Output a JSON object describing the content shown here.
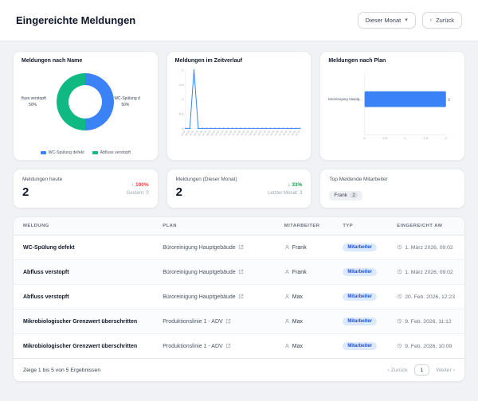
{
  "header": {
    "title": "Eingereichte Meldungen",
    "period_value": "Dieser Monat",
    "back_label": "Zurück"
  },
  "icons": {
    "caret_down": "▾",
    "chevron_left": "‹",
    "chevron_right": "›"
  },
  "charts": {
    "by_name": {
      "title": "Meldungen nach Name",
      "type": "doughnut",
      "segments": [
        {
          "label": "WC-Spülung defekt",
          "pct": 50,
          "color": "#3b82f6"
        },
        {
          "label": "Abfluss verstopft",
          "pct": 50,
          "color": "#10b981"
        }
      ],
      "callout_left": {
        "label": "fluss verstopft",
        "value": "50%"
      },
      "callout_right": {
        "label": "WC-Spülung d",
        "value": "50%"
      }
    },
    "over_time": {
      "title": "Meldungen im Zeitverlauf",
      "type": "line",
      "color": "#3b82f6",
      "y_max": 2,
      "y_ticks": [
        0,
        0.5,
        1,
        1.5,
        2
      ],
      "x": [
        "02.02",
        "03.02",
        "04.02",
        "05.02",
        "06.02",
        "07.02",
        "08.02",
        "09.02",
        "10.02",
        "11.02",
        "12.02",
        "13.02",
        "14.02",
        "15.02",
        "16.02",
        "17.02",
        "18.02",
        "19.02",
        "20.02",
        "21.02",
        "22.02",
        "23.02",
        "24.02",
        "25.02",
        "26.02",
        "27.02",
        "28.02",
        "01.03"
      ],
      "values": [
        0,
        0,
        2,
        0,
        0,
        0,
        0,
        0,
        0,
        0,
        0,
        0,
        0,
        0,
        0,
        0,
        0,
        0,
        0,
        0,
        0,
        0,
        0,
        0,
        0,
        0,
        0,
        0
      ]
    },
    "by_plan": {
      "title": "Meldungen nach Plan",
      "type": "bar-horizontal",
      "color": "#3b82f6",
      "x_max": 2,
      "x_ticks": [
        0,
        0.5,
        1,
        1.5,
        2
      ],
      "categories": [
        "Büroreinigung Hauptg..."
      ],
      "values": [
        2
      ]
    }
  },
  "stats": [
    {
      "title": "Meldungen heute",
      "value": "2",
      "delta": "↑ 100%",
      "delta_color": "#ef4444",
      "subtitle": "Gestern: 0"
    },
    {
      "title": "Meldungen (Dieser Monat)",
      "value": "2",
      "delta": "↓ 33%",
      "delta_color": "#16a34a",
      "subtitle": "Letzter Monat: 3"
    },
    {
      "title": "Top Meldende Mitarbeiter",
      "chip": {
        "name": "Frank",
        "count": "2"
      }
    }
  ],
  "table": {
    "columns": [
      "MELDUNG",
      "PLAN",
      "MITARBEITER",
      "TYP",
      "EINGEREICHT AM"
    ],
    "rows": [
      {
        "meldung": "WC-Spülung defekt",
        "plan": "Büroreinigung Hauptgebäude",
        "mitarbeiter": "Frank",
        "typ": "Mitarbeiter",
        "eingereicht": "1. März 2026, 09:02"
      },
      {
        "meldung": "Abfluss verstopft",
        "plan": "Büroreinigung Hauptgebäude",
        "mitarbeiter": "Frank",
        "typ": "Mitarbeiter",
        "eingereicht": "1. März 2026, 09:02"
      },
      {
        "meldung": "Abfluss verstopft",
        "plan": "Büroreinigung Hauptgebäude",
        "mitarbeiter": "Max",
        "typ": "Mitarbeiter",
        "eingereicht": "20. Feb. 2026, 12:23"
      },
      {
        "meldung": "Mikrobiologischer Grenzwert überschritten",
        "plan": "Produktionslinie 1 - ADV",
        "mitarbeiter": "Max",
        "typ": "Mitarbeiter",
        "eingereicht": "9. Feb. 2026, 11:12"
      },
      {
        "meldung": "Mikrobiologischer Grenzwert überschritten",
        "plan": "Produktionslinie 1 - ADV",
        "mitarbeiter": "Max",
        "typ": "Mitarbeiter",
        "eingereicht": "9. Feb. 2026, 10:09"
      }
    ],
    "footer": {
      "summary": "Zeige 1 bis 5 von 5 Ergebnissen",
      "prev": "Zurück",
      "page": "1",
      "next": "Weiter"
    }
  }
}
